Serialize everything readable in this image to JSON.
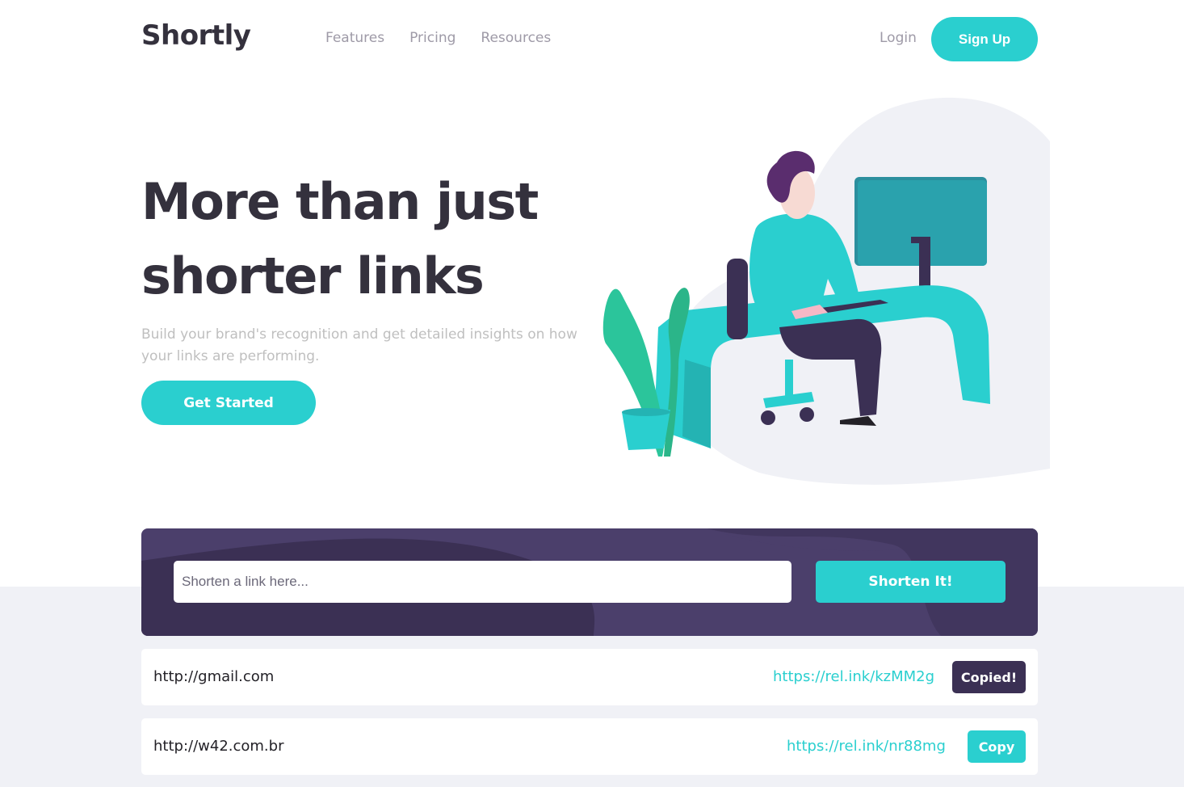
{
  "header": {
    "logo": "Shortly",
    "nav": [
      "Features",
      "Pricing",
      "Resources"
    ],
    "login": "Login",
    "signup": "Sign Up"
  },
  "hero": {
    "title_line1": "More than just",
    "title_line2": "shorter links",
    "subtitle": "Build your brand's recognition and get detailed insights on how your links are performing.",
    "cta": "Get Started"
  },
  "shorten": {
    "placeholder": "Shorten a link here...",
    "button": "Shorten It!"
  },
  "results": [
    {
      "original": "http://gmail.com",
      "short": "https://rel.ink/kzMM2g",
      "button": "Copied!",
      "copied": true
    },
    {
      "original": "http://w42.com.br",
      "short": "https://rel.ink/nr88mg",
      "button": "Copy",
      "copied": false
    }
  ],
  "colors": {
    "accent": "#2acfcf",
    "dark_violet": "#3b3054",
    "violet": "#4b3f6b",
    "text_dark": "#34313d",
    "grey": "#9e9aa7",
    "bg_light": "#f0f1f6"
  },
  "illustration": "person-working-at-desk-illustration"
}
